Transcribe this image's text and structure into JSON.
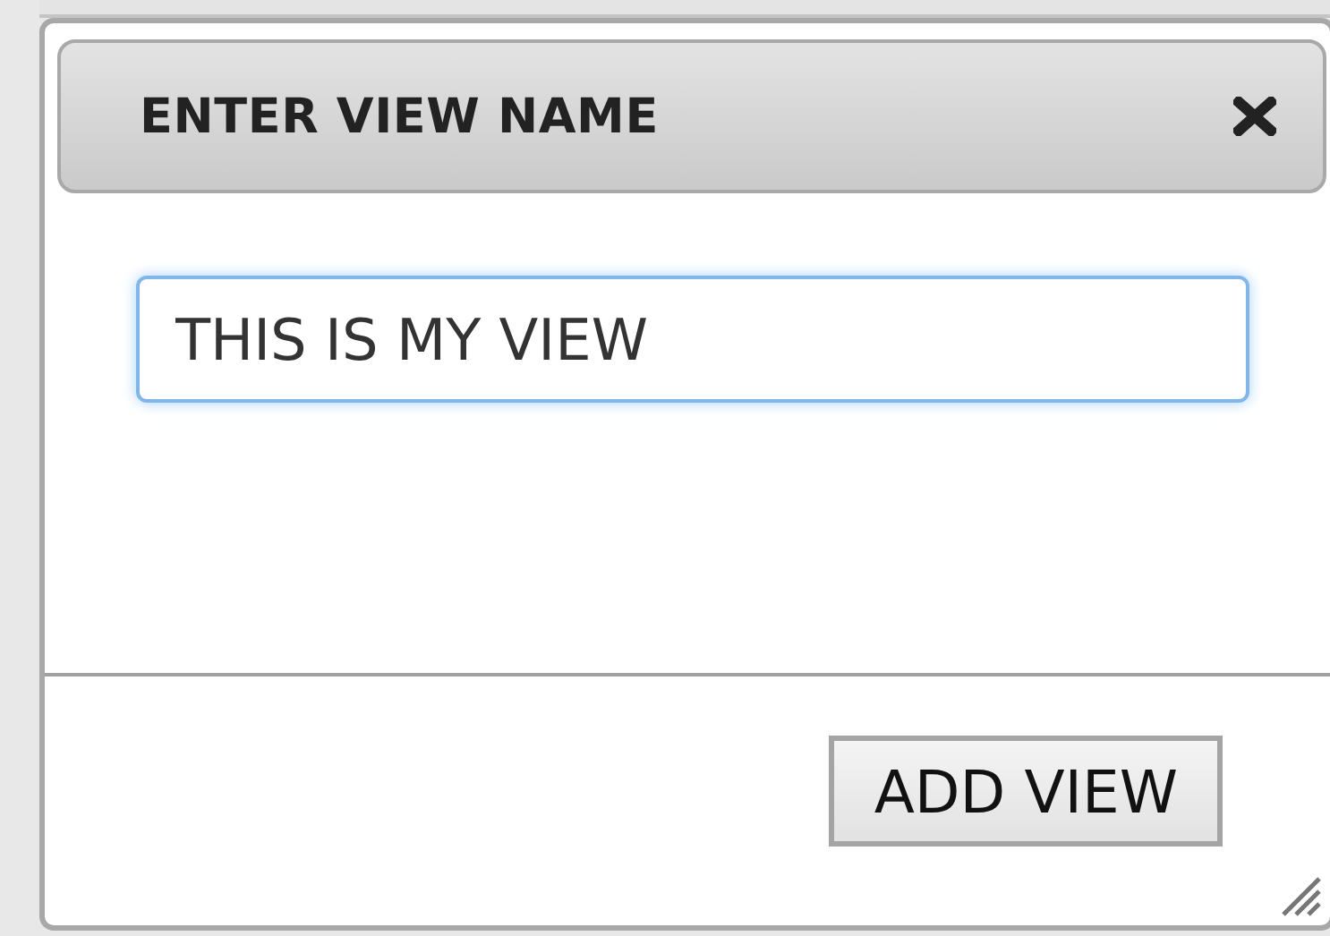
{
  "dialog": {
    "title": "ENTER VIEW NAME",
    "view_name_field": {
      "value": "THIS IS MY VIEW",
      "focused": true
    },
    "buttons": [
      {
        "label": "ADD VIEW"
      }
    ]
  }
}
